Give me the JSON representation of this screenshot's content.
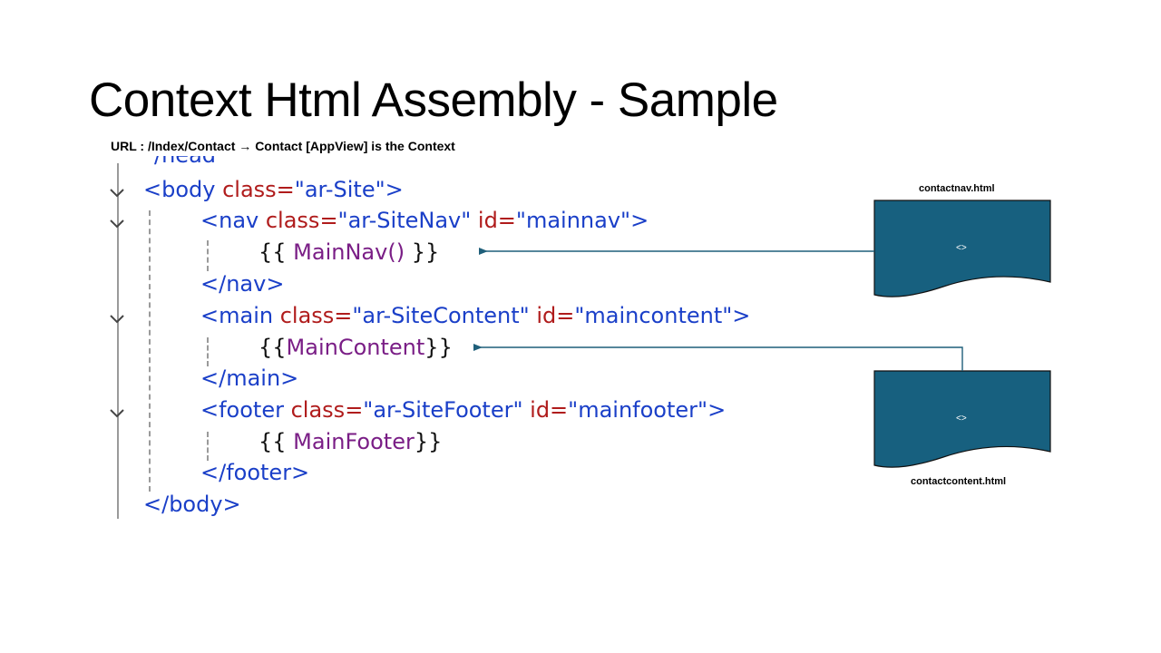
{
  "slide": {
    "title": "Context Html Assembly - Sample",
    "subtitle": "URL : /Index/Contact → Contact [AppView] is the Context"
  },
  "code": {
    "line_partial": "/head",
    "body_open": {
      "tag": "<body ",
      "attr": "class=",
      "val": "\"ar-Site\"",
      "close": ">"
    },
    "nav_open": {
      "tag": "<nav ",
      "attr1": "class=",
      "val1": "\"ar-SiteNav\"",
      "attr2": " id=",
      "val2": "\"mainnav\"",
      "close": ">"
    },
    "nav_expr": {
      "open": "{{ ",
      "fn": "MainNav()",
      "close": " }}"
    },
    "nav_close": "</nav>",
    "main_open": {
      "tag": "<main ",
      "attr1": "class=",
      "val1": "\"ar-SiteContent\"",
      "attr2": " id=",
      "val2": "\"maincontent\"",
      "close": ">"
    },
    "main_expr": {
      "open": "{{",
      "fn": "MainContent",
      "close": "}}"
    },
    "main_close": "</main>",
    "footer_open": {
      "tag": "<footer ",
      "attr1": "class=",
      "val1": "\"ar-SiteFooter\"",
      "attr2": " id=",
      "val2": "\"mainfooter\"",
      "close": ">"
    },
    "footer_expr": {
      "open": "{{ ",
      "fn": "MainFooter",
      "close": "}}"
    },
    "footer_close": "</footer>",
    "body_close": "</body>"
  },
  "documents": {
    "nav_doc": {
      "label": "contactnav.html",
      "icon_text": "<>"
    },
    "content_doc": {
      "label": "contactcontent.html",
      "icon_text": "<>"
    }
  },
  "colors": {
    "doc_fill": "#17607f",
    "arrow": "#1f5f7a"
  }
}
